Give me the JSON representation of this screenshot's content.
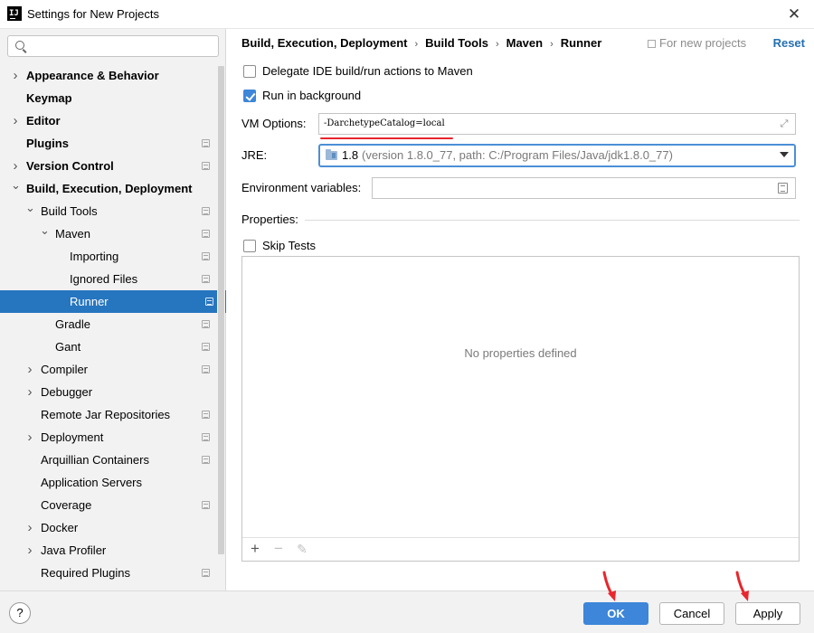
{
  "window": {
    "title": "Settings for New Projects",
    "close_glyph": "✕",
    "app_icon_text": "IJ"
  },
  "search": {
    "placeholder": "",
    "value": ""
  },
  "sidebar": {
    "items": [
      {
        "label": "Appearance & Behavior",
        "arrow": "right",
        "bold": true,
        "project": false
      },
      {
        "label": "Keymap",
        "arrow": "",
        "bold": true,
        "project": false
      },
      {
        "label": "Editor",
        "arrow": "right",
        "bold": true,
        "project": false
      },
      {
        "label": "Plugins",
        "arrow": "",
        "bold": true,
        "project": true
      },
      {
        "label": "Version Control",
        "arrow": "right",
        "bold": true,
        "project": true
      },
      {
        "label": "Build, Execution, Deployment",
        "arrow": "down",
        "bold": true,
        "project": false
      },
      {
        "label": "Build Tools",
        "arrow": "down",
        "bold": false,
        "project": true
      },
      {
        "label": "Maven",
        "arrow": "down",
        "bold": false,
        "project": true
      },
      {
        "label": "Importing",
        "arrow": "",
        "bold": false,
        "project": true
      },
      {
        "label": "Ignored Files",
        "arrow": "",
        "bold": false,
        "project": true
      },
      {
        "label": "Runner",
        "arrow": "",
        "bold": false,
        "project": true,
        "selected": true
      },
      {
        "label": "Gradle",
        "arrow": "",
        "bold": false,
        "project": true
      },
      {
        "label": "Gant",
        "arrow": "",
        "bold": false,
        "project": true
      },
      {
        "label": "Compiler",
        "arrow": "right",
        "bold": false,
        "project": true
      },
      {
        "label": "Debugger",
        "arrow": "right",
        "bold": false,
        "project": false
      },
      {
        "label": "Remote Jar Repositories",
        "arrow": "",
        "bold": false,
        "project": true
      },
      {
        "label": "Deployment",
        "arrow": "right",
        "bold": false,
        "project": true
      },
      {
        "label": "Arquillian Containers",
        "arrow": "",
        "bold": false,
        "project": true
      },
      {
        "label": "Application Servers",
        "arrow": "",
        "bold": false,
        "project": false
      },
      {
        "label": "Coverage",
        "arrow": "",
        "bold": false,
        "project": true
      },
      {
        "label": "Docker",
        "arrow": "right",
        "bold": false,
        "project": false
      },
      {
        "label": "Java Profiler",
        "arrow": "right",
        "bold": false,
        "project": false
      },
      {
        "label": "Required Plugins",
        "arrow": "",
        "bold": false,
        "project": true
      }
    ]
  },
  "breadcrumb": [
    "Build, Execution, Deployment",
    "Build Tools",
    "Maven",
    "Runner"
  ],
  "header": {
    "scope_text": "For new projects",
    "reset_label": "Reset"
  },
  "options": {
    "delegate_label": "Delegate IDE build/run actions to Maven",
    "delegate_checked": false,
    "background_label": "Run in background",
    "background_checked": true,
    "vm_label": "VM Options:",
    "vm_value": "-DarchetypeCatalog=local",
    "jre_label": "JRE:",
    "jre_version": "1.8",
    "jre_detail": "(version 1.8.0_77, path: C:/Program Files/Java/jdk1.8.0_77)",
    "env_label": "Environment variables:",
    "env_value": "",
    "properties_label": "Properties:",
    "skip_tests_label": "Skip Tests",
    "skip_tests_checked": false,
    "empty_properties_text": "No properties defined"
  },
  "toolbar": {
    "add": "+",
    "remove": "−",
    "edit": "✎"
  },
  "footer": {
    "help": "?",
    "ok_label": "OK",
    "cancel_label": "Cancel",
    "apply_label": "Apply"
  },
  "colors": {
    "accent": "#3d86d9",
    "selection": "#2675bf",
    "link": "#2470b3",
    "annotation_red": "#e8262d"
  },
  "icons": {
    "search": "search-icon",
    "expand": "expand-icon",
    "jre": "folder-icon",
    "dropdown": "chevron-down-icon",
    "browse": "browse-icon",
    "project_scope": "project-scope-icon"
  }
}
